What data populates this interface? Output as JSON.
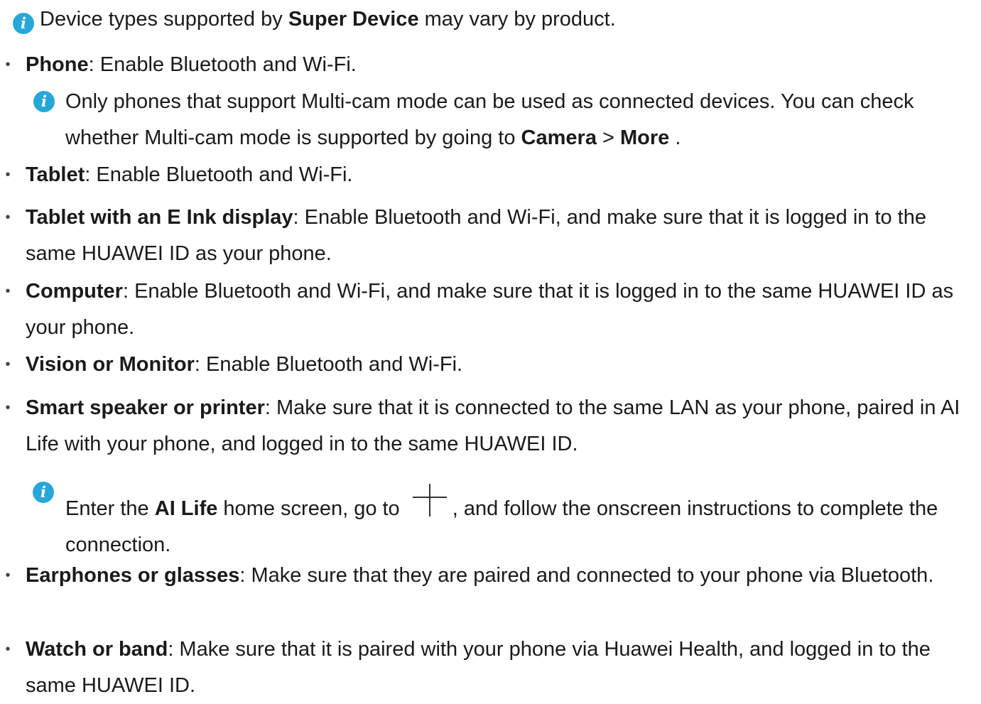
{
  "top_note": {
    "text_a": "Device types supported by ",
    "text_b": "Super Device",
    "text_c": " may vary by product."
  },
  "items": [
    {
      "term": "Phone",
      "text": ": Enable Bluetooth and Wi-Fi."
    },
    {
      "term": "Tablet",
      "text": ": Enable Bluetooth and Wi-Fi."
    },
    {
      "term": "Tablet with an E Ink display",
      "text": ": Enable Bluetooth and Wi-Fi, and make sure that it is logged in to the same HUAWEI ID as your phone."
    },
    {
      "term": "Computer",
      "text": ": Enable Bluetooth and Wi-Fi, and make sure that it is logged in to the same HUAWEI ID as your phone."
    },
    {
      "term": "Vision or Monitor",
      "text": ": Enable Bluetooth and Wi-Fi."
    },
    {
      "term": "Smart speaker or printer",
      "text": ": Make sure that it is connected to the same LAN as your phone, paired in AI Life with your phone, and logged in to the same HUAWEI ID."
    },
    {
      "term": "Earphones or glasses",
      "text": ": Make sure that they are paired and connected to your phone via Bluetooth."
    },
    {
      "term": "Watch or band",
      "text": ": Make sure that it is paired with your phone via Huawei Health, and logged in to the same HUAWEI ID."
    }
  ],
  "phone_note": {
    "text_a": "Only phones that support Multi-cam mode can be used as connected devices. You can check whether Multi-cam mode is supported by going to ",
    "camera": "Camera",
    "sep": " > ",
    "more": "More",
    "end": " ."
  },
  "speaker_note": {
    "text_a": "Enter the ",
    "app": "AI Life",
    "text_b": " home screen, go to ",
    "text_c": ", and follow the onscreen instructions to complete the connection."
  },
  "bullet_char": "•",
  "info_glyph": "i",
  "colors": {
    "info_icon": "#27a7d9",
    "text": "#1a1a1a"
  }
}
